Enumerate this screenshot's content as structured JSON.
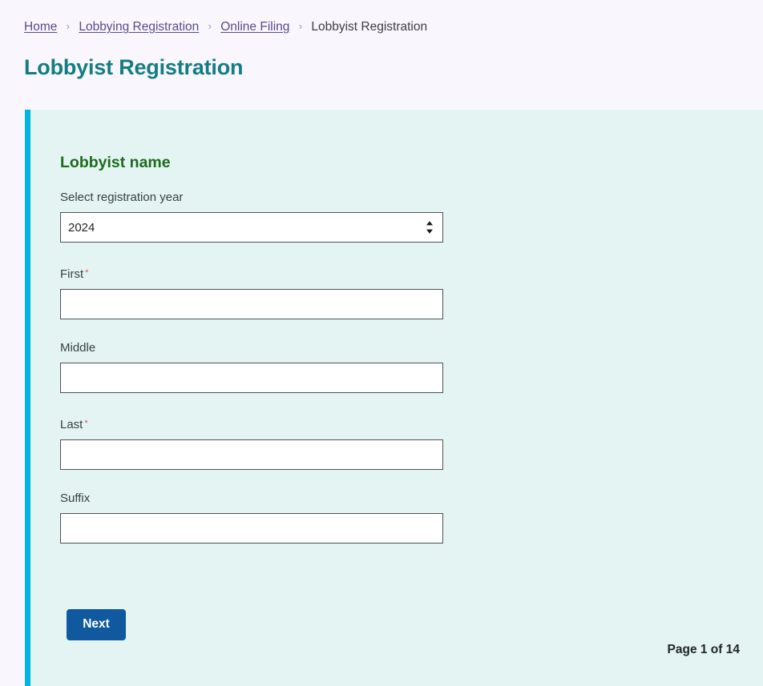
{
  "breadcrumb": {
    "items": [
      {
        "label": "Home",
        "is_link": true
      },
      {
        "label": "Lobbying Registration",
        "is_link": true
      },
      {
        "label": "Online Filing",
        "is_link": true
      },
      {
        "label": "Lobbyist Registration",
        "is_link": false
      }
    ],
    "separator": "›"
  },
  "page": {
    "title": "Lobbyist Registration"
  },
  "form": {
    "section_heading": "Lobbyist name",
    "fields": {
      "year": {
        "label": "Select registration year",
        "value": "2024",
        "required": false,
        "icon": "stepper-updown-icon"
      },
      "first": {
        "label": "First",
        "value": "",
        "placeholder": "",
        "required": true,
        "required_marker": "*"
      },
      "middle": {
        "label": "Middle",
        "value": "",
        "placeholder": "",
        "required": false
      },
      "last": {
        "label": "Last",
        "value": "",
        "placeholder": "",
        "required": true,
        "required_marker": "*"
      },
      "suffix": {
        "label": "Suffix",
        "value": "",
        "placeholder": "",
        "required": false
      }
    },
    "next_label": "Next",
    "page_indicator": "Page 1 of 14"
  },
  "colors": {
    "page_background": "#f9f7fd",
    "panel_background": "#e4f4f2",
    "accent_bar": "#00b5e2",
    "title_teal": "#127d84",
    "heading_green": "#1d6b1d",
    "link_purple": "#5b4a8a",
    "required_red": "#e0564f",
    "button_blue": "#10599e"
  }
}
